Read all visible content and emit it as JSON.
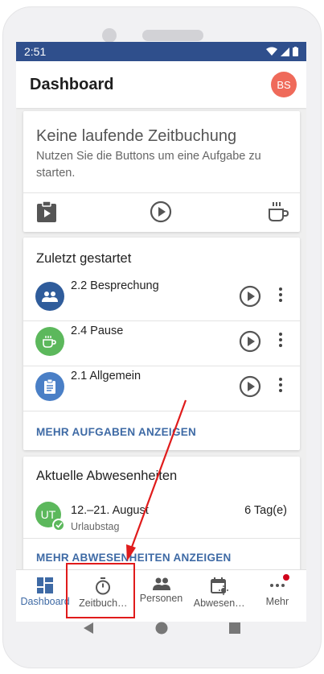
{
  "status_bar": {
    "time": "2:51"
  },
  "app_bar": {
    "title": "Dashboard",
    "avatar_initials": "BS"
  },
  "running_card": {
    "title": "Keine laufende Zeitbuchung",
    "subtitle": "Nutzen Sie die Buttons um eine Aufgabe zu starten.",
    "actions": [
      "clipboard-play-icon",
      "play-circle-icon",
      "coffee-icon"
    ]
  },
  "recent": {
    "heading": "Zuletzt gestartet",
    "items": [
      {
        "label": "2.2 Besprechung",
        "color": "#2f5c9b",
        "icon": "people-icon"
      },
      {
        "label": "2.4 Pause",
        "color": "#5cb85c",
        "icon": "coffee-icon"
      },
      {
        "label": "2.1 Allgemein",
        "color": "#4a7fc6",
        "icon": "clipboard-icon"
      }
    ],
    "more_link": "MEHR AUFGABEN ANZEIGEN"
  },
  "absences": {
    "heading": "Aktuelle Abwesenheiten",
    "items": [
      {
        "initials": "UT",
        "date": "12.–21. August",
        "type": "Urlaubstag",
        "days": "6 Tag(e)",
        "color": "#5cb85c"
      }
    ],
    "more_link": "MEHR ABWESENHEITEN ANZEIGEN"
  },
  "bottom_nav": [
    {
      "label": "Dashboard",
      "icon": "dashboard-icon",
      "active": true
    },
    {
      "label": "Zeitbuch…",
      "icon": "stopwatch-icon",
      "active": false
    },
    {
      "label": "Personen",
      "icon": "people-icon",
      "active": false
    },
    {
      "label": "Abwesen…",
      "icon": "calendar-icon",
      "active": false
    },
    {
      "label": "Mehr",
      "icon": "more-icon",
      "active": false,
      "badge": true
    }
  ],
  "colors": {
    "primary": "#2f4f8c",
    "accent": "#3e6aa5",
    "highlight": "#e01b1b"
  }
}
